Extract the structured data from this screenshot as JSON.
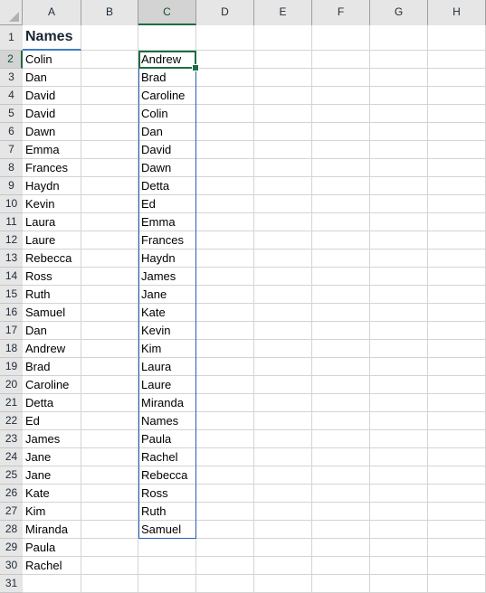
{
  "grid": {
    "select_all_icon": "select-all-triangle-icon",
    "column_headers": [
      "A",
      "B",
      "C",
      "D",
      "E",
      "F",
      "G",
      "H"
    ],
    "row_headers": [
      "1",
      "2",
      "3",
      "4",
      "5",
      "6",
      "7",
      "8",
      "9",
      "10",
      "11",
      "12",
      "13",
      "14",
      "15",
      "16",
      "17",
      "18",
      "19",
      "20",
      "21",
      "22",
      "23",
      "24",
      "25",
      "26",
      "27",
      "28",
      "29",
      "30",
      "31"
    ],
    "selected_column": "C",
    "selected_row": "2",
    "active_cell": "C2",
    "selection_range": "C2:C28"
  },
  "colors": {
    "header_fill": "#e6e6e6",
    "header_selected_fill": "#d3d3d3",
    "active_border": "#1e6c41",
    "range_border": "#2a5db0",
    "table_header_underline": "#3f7cc4",
    "gridline": "#d4d4d4"
  },
  "columnA": {
    "header": "Names",
    "values": [
      "Colin",
      "Dan",
      "David",
      "David",
      "Dawn",
      "Emma",
      "Frances",
      "Haydn",
      "Kevin",
      "Laura",
      "Laure",
      "Rebecca",
      "Ross",
      "Ruth",
      "Samuel",
      "Dan",
      "Andrew",
      "Brad",
      "Caroline",
      "Detta",
      "Ed",
      "James",
      "Jane",
      "Jane",
      "Kate",
      "Kim",
      "Miranda",
      "Paula",
      "Rachel"
    ]
  },
  "columnC": {
    "values": [
      "Andrew",
      "Brad",
      "Caroline",
      "Colin",
      "Dan",
      "David",
      "Dawn",
      "Detta",
      "Ed",
      "Emma",
      "Frances",
      "Haydn",
      "James",
      "Jane",
      "Kate",
      "Kevin",
      "Kim",
      "Laura",
      "Laure",
      "Miranda",
      "Names",
      "Paula",
      "Rachel",
      "Rebecca",
      "Ross",
      "Ruth",
      "Samuel"
    ]
  }
}
